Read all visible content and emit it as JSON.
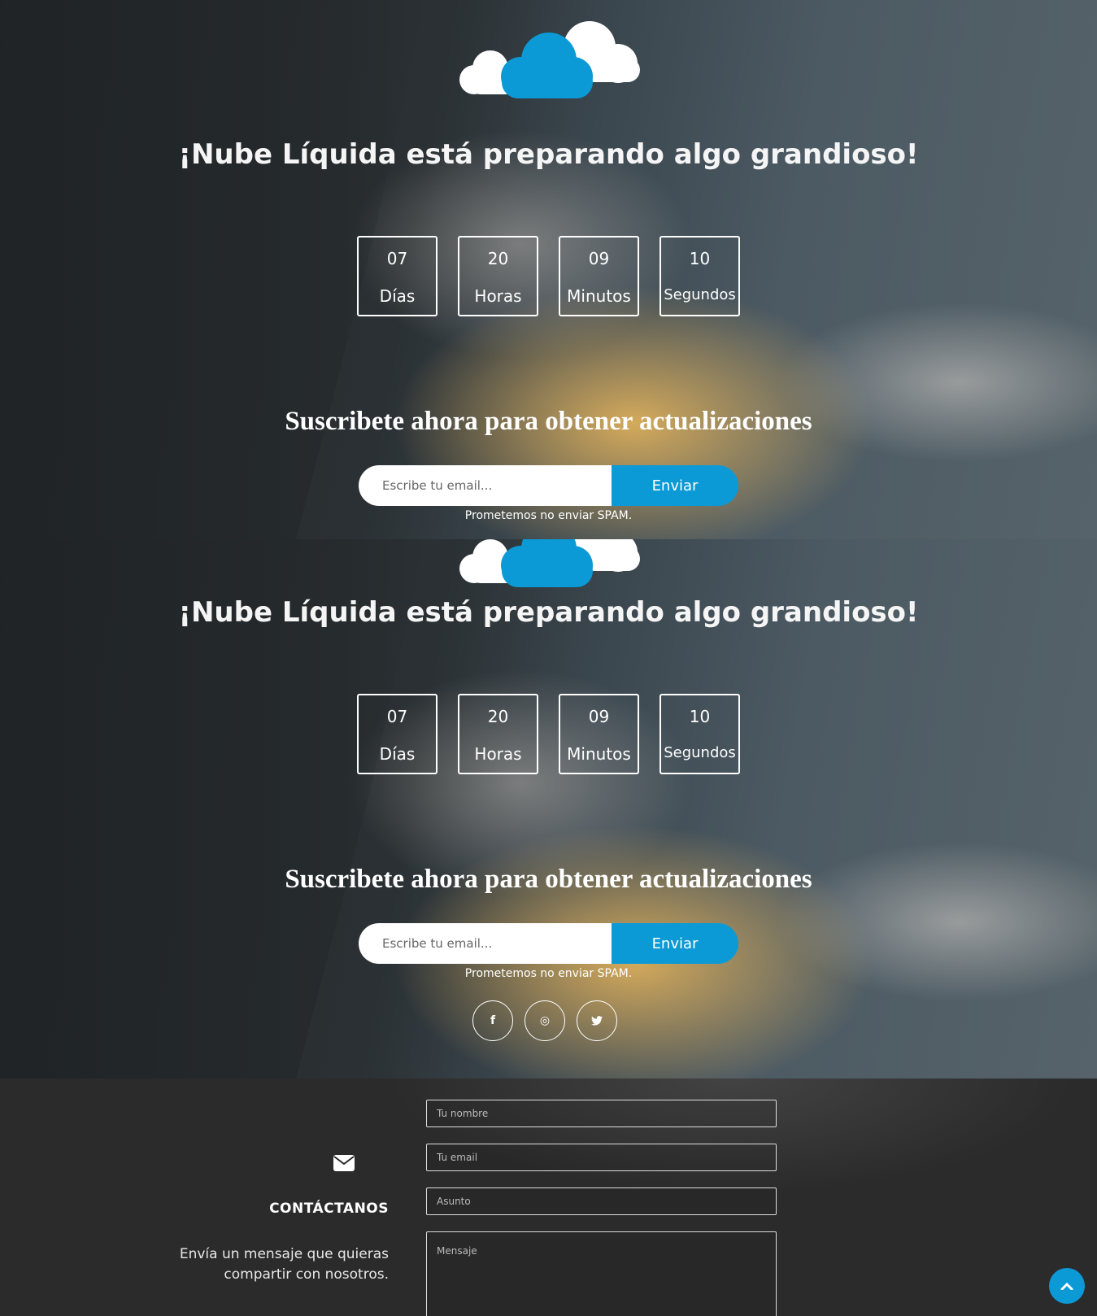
{
  "brand": {
    "name": "Nube Líquida",
    "headline": "¡Nube Líquida está preparando algo grandioso!",
    "accent_color": "#0b9ad6"
  },
  "countdown": [
    {
      "value": "07",
      "label": "Días"
    },
    {
      "value": "20",
      "label": "Horas"
    },
    {
      "value": "09",
      "label": "Minutos"
    },
    {
      "value": "10",
      "label": "Segundos"
    }
  ],
  "subscribe": {
    "title": "Suscribete ahora para obtener actualizaciones",
    "placeholder": "Escribe tu email...",
    "button_label": "Enviar",
    "note": "Prometemos no enviar SPAM."
  },
  "social": [
    {
      "icon": "facebook-icon",
      "glyph": "f"
    },
    {
      "icon": "instagram-icon",
      "glyph": "◎"
    },
    {
      "icon": "twitter-icon",
      "glyph": "🐦"
    }
  ],
  "contact": {
    "icon": "envelope-icon",
    "title": "CONTÁCTANOS",
    "description": "Envía un mensaje que quieras compartir con nosotros.",
    "fields": {
      "name_placeholder": "Tu nombre",
      "email_placeholder": "Tu email",
      "subject_placeholder": "Asunto",
      "message_placeholder": "Mensaje"
    }
  },
  "scroll_top": {
    "icon": "chevron-up-icon"
  }
}
